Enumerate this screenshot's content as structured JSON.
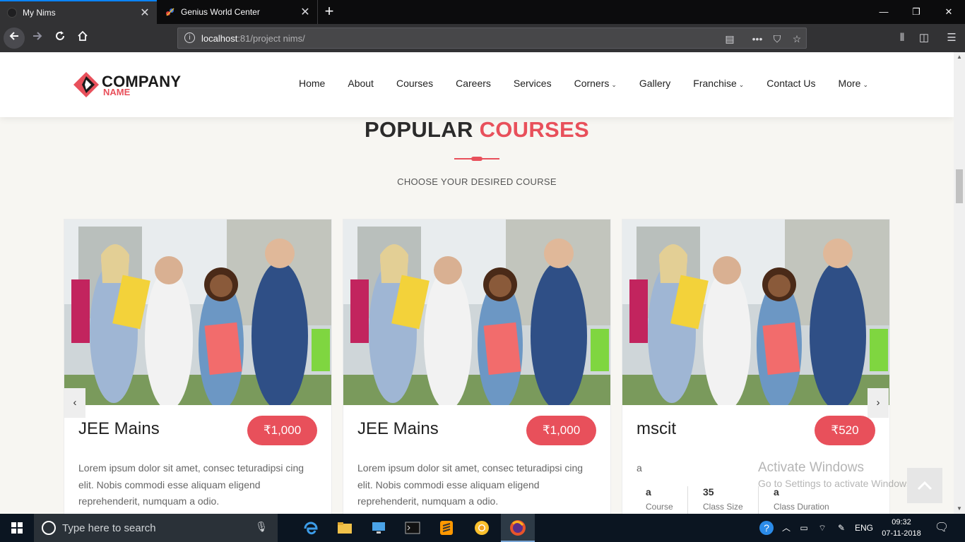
{
  "browser": {
    "tabs": [
      {
        "title": "My Nims",
        "active": true
      },
      {
        "title": "Genius World Center",
        "active": false
      }
    ],
    "url_host": "localhost",
    "url_rest": ":81/project nims/",
    "window_controls": {
      "minimize": "—",
      "maximize": "❐",
      "close": "✕"
    }
  },
  "site": {
    "logo": {
      "line1": "COMPANY",
      "line2": "NAME"
    },
    "menu": [
      {
        "label": "Home",
        "dropdown": false
      },
      {
        "label": "About",
        "dropdown": false
      },
      {
        "label": "Courses",
        "dropdown": false
      },
      {
        "label": "Careers",
        "dropdown": false
      },
      {
        "label": "Services",
        "dropdown": false
      },
      {
        "label": "Corners",
        "dropdown": true
      },
      {
        "label": "Gallery",
        "dropdown": false
      },
      {
        "label": "Franchise",
        "dropdown": true
      },
      {
        "label": "Contact Us",
        "dropdown": false
      },
      {
        "label": "More",
        "dropdown": true
      }
    ],
    "section": {
      "title_main": "POPULAR ",
      "title_accent": "COURSES",
      "subtitle": "CHOOSE YOUR DESIRED COURSE"
    },
    "courses": [
      {
        "title": "JEE Mains",
        "price": "₹1,000",
        "description": "Lorem ipsum dolor sit amet, consec teturadipsi cing elit. Nobis commodi esse aliquam eligend reprehenderit, numquam a odio."
      },
      {
        "title": "JEE Mains",
        "price": "₹1,000",
        "description": "Lorem ipsum dolor sit amet, consec teturadipsi cing elit. Nobis commodi esse aliquam eligend reprehenderit, numquam a odio."
      },
      {
        "title": "mscit",
        "price": "₹520",
        "description": "a",
        "stats": [
          {
            "value": "a",
            "label": "Course"
          },
          {
            "value": "35",
            "label": "Class Size"
          },
          {
            "value": "a",
            "label": "Class Duration"
          }
        ]
      }
    ],
    "carousel": {
      "prev": "‹",
      "next": "›"
    }
  },
  "watermark": {
    "line1": "Activate Windows",
    "line2": "Go to Settings to activate Windows."
  },
  "taskbar": {
    "search_placeholder": "Type here to search",
    "language": "ENG",
    "time": "09:32",
    "date": "07-11-2018"
  },
  "colors": {
    "accent": "#e8505b",
    "chrome_dark": "#0c0c0d",
    "taskbar": "#0b1521"
  },
  "icons": [
    "back-arrow-icon",
    "forward-arrow-icon",
    "reload-icon",
    "home-icon",
    "info-icon",
    "reader-view-icon",
    "page-actions-icon",
    "pocket-icon",
    "bookmark-star-icon",
    "library-icon",
    "sidebar-icon",
    "menu-icon",
    "windows-start-icon",
    "search-icon",
    "microphone-icon",
    "edge-icon",
    "file-explorer-icon",
    "remote-desktop-icon",
    "terminal-icon",
    "sublime-icon",
    "chrome-icon",
    "firefox-icon",
    "help-icon",
    "chevron-up-icon",
    "battery-icon",
    "wifi-icon",
    "pen-icon",
    "notification-icon"
  ]
}
